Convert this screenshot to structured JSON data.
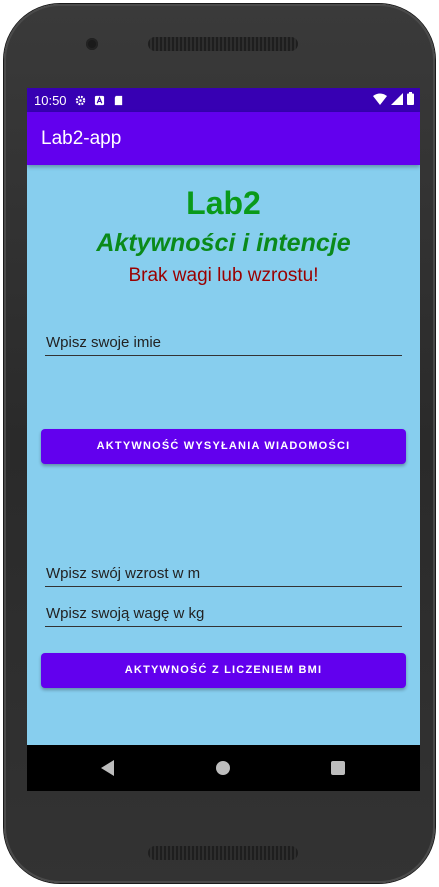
{
  "status_bar": {
    "time": "10:50",
    "icons_left": [
      "gear-icon",
      "a-icon",
      "sd-card-icon"
    ],
    "icons_right": [
      "wifi-icon",
      "signal-icon",
      "battery-icon"
    ]
  },
  "app_bar": {
    "title": "Lab2-app"
  },
  "main": {
    "heading": "Lab2",
    "subheading": "Aktywności i intencje",
    "error_text": "Brak wagi lub wzrostu!",
    "name_field": {
      "placeholder": "Wpisz swoje imie"
    },
    "message_button": {
      "label": "AKTYWNOŚĆ WYSYŁANIA WIADOMOŚCI"
    },
    "height_field": {
      "placeholder": "Wpisz swój wzrost w m"
    },
    "weight_field": {
      "placeholder": "Wpisz swoją wagę w kg"
    },
    "bmi_button": {
      "label": "AKTYWNOŚĆ Z LICZENIEM BMI"
    }
  },
  "colors": {
    "status_bar": "#3700b3",
    "app_bar": "#6200ee",
    "background": "#87ceee",
    "heading": "#0a9a1a",
    "error": "#9a0000",
    "button": "#6200ee"
  }
}
